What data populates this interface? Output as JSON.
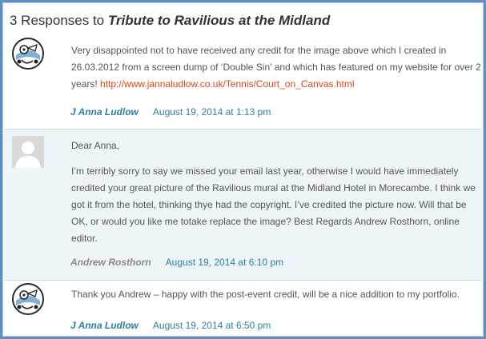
{
  "heading": {
    "count_text": "3 Responses to ",
    "title": "Tribute to Ravilious at the Midland"
  },
  "comments": [
    {
      "author": "J Anna Ludlow",
      "date": "August 19, 2014 at 1:13 pm",
      "text_before_link": "Very disappointed not to have received any credit for the image above which I created in 26.03.2012 from a screen dump of ‘Double Sin’ and which has featured on my website for over 2 years! ",
      "link": "http://www.jannaludlow.co.uk/Tennis/Court_on_Canvas.html",
      "avatar_icon": "cartoon-character-avatar-icon"
    },
    {
      "author": "Andrew Rosthorn",
      "date": "August 19, 2014 at 6:10 pm",
      "greeting": "Dear Anna,",
      "text": "I’m terribly sorry to say we missed your email last year, otherwise I would have immediately credited your great picture of the Ravilious mural at the Midland Hotel in Morecambe. I think we got it from the hotel, thinking thye had the copyright. I’ve credited the picture now. Will that be OK, or would you like me totake replace the image? Best Regards Andrew Rosthorn, online editor.",
      "avatar_icon": "default-user-avatar-icon"
    },
    {
      "author": "J Anna Ludlow",
      "date": "August 19, 2014 at 6:50 pm",
      "text": "Thank you Andrew – happy with the post-event credit, will be a nice addition to my portfolio.",
      "avatar_icon": "cartoon-character-avatar-icon"
    }
  ],
  "colors": {
    "border": "#5f8fc0",
    "link": "#e0461a",
    "author": "#2b7fa3",
    "highlight_bg": "#eef5f9"
  }
}
